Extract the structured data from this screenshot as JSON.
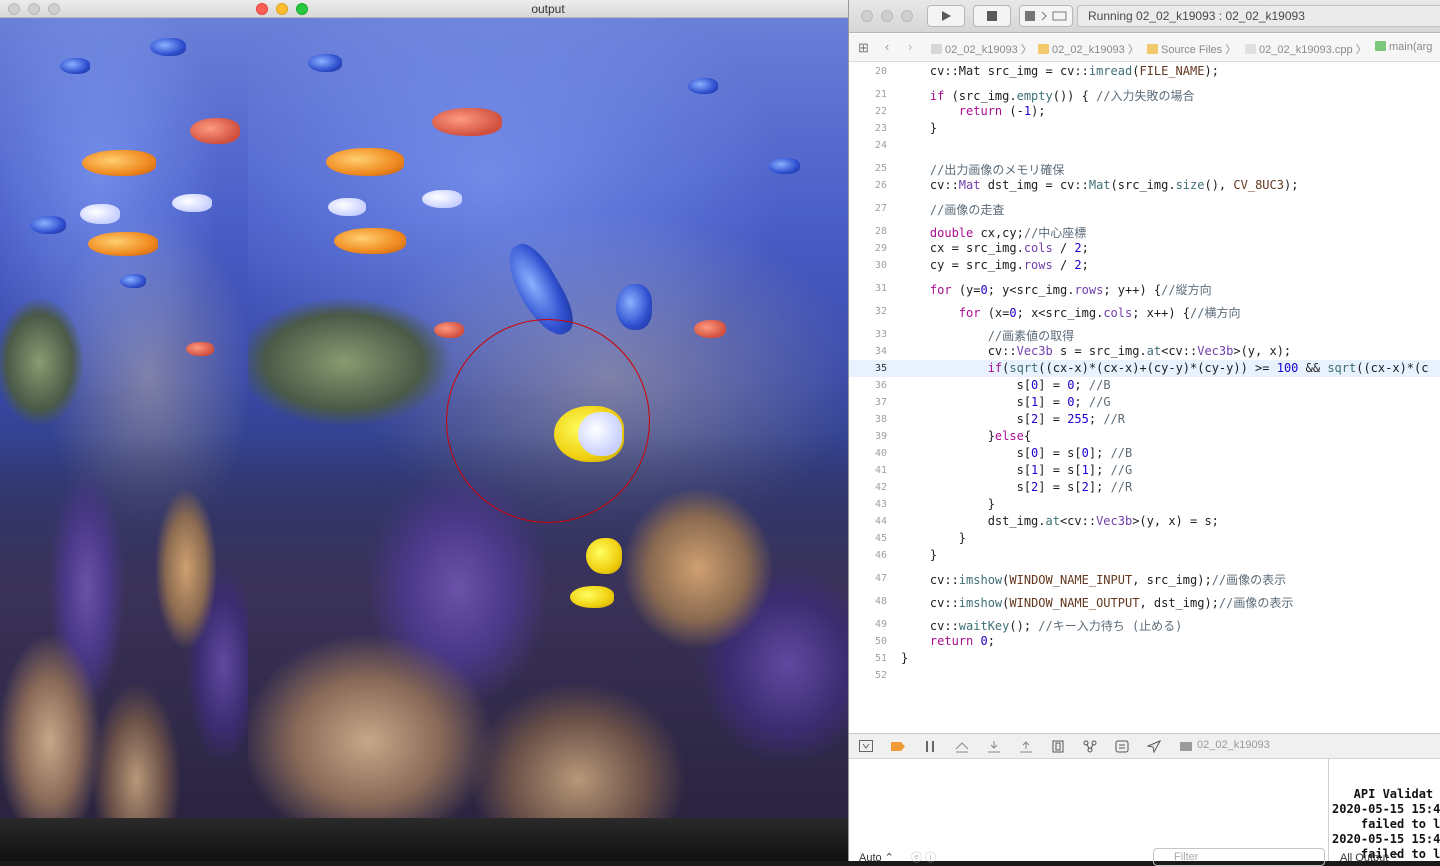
{
  "input_window": {
    "title": ""
  },
  "output_window": {
    "title": "output"
  },
  "xcode": {
    "status": "Running 02_02_k19093 : 02_02_k19093",
    "breadcrumb": [
      "02_02_k19093",
      "02_02_k19093",
      "Source Files",
      "02_02_k19093.cpp",
      "main(arg"
    ],
    "current_line": 35,
    "code_lines": [
      {
        "n": "20",
        "html": "    cv::Mat src_img = cv::<span class='fn'>imread</span>(<span class='cnst'>FILE_NAME</span>);"
      },
      {
        "n": "21",
        "html": "    <span class='kw'>if</span> (src_img.<span class='fn'>empty</span>()) { <span class='cm'>//入力失敗の場合</span>"
      },
      {
        "n": "22",
        "html": "        <span class='kw'>return</span> (-<span class='num'>1</span>);"
      },
      {
        "n": "23",
        "html": "    }"
      },
      {
        "n": "24",
        "html": ""
      },
      {
        "n": "25",
        "html": "    <span class='cm'>//出力画像のメモリ確保</span>"
      },
      {
        "n": "26",
        "html": "    cv::<span class='ty'>Mat</span> dst_img = cv::<span class='fn'>Mat</span>(src_img.<span class='fn'>size</span>(), <span class='cnst'>CV_8UC3</span>);"
      },
      {
        "n": "27",
        "html": "    <span class='cm'>//画像の走査</span>"
      },
      {
        "n": "28",
        "html": "    <span class='kw'>double</span> cx,cy;<span class='cm'>//中心座標</span>"
      },
      {
        "n": "29",
        "html": "    cx = src_img.<span class='ty'>cols</span> / <span class='num'>2</span>;"
      },
      {
        "n": "30",
        "html": "    cy = src_img.<span class='ty'>rows</span> / <span class='num'>2</span>;"
      },
      {
        "n": "31",
        "html": "    <span class='kw'>for</span> (y=<span class='num'>0</span>; y&lt;src_img.<span class='ty'>rows</span>; y++) {<span class='cm'>//縦方向</span>"
      },
      {
        "n": "32",
        "html": "        <span class='kw'>for</span> (x=<span class='num'>0</span>; x&lt;src_img.<span class='ty'>cols</span>; x++) {<span class='cm'>//横方向</span>"
      },
      {
        "n": "33",
        "html": "            <span class='cm'>//画素値の取得</span>"
      },
      {
        "n": "34",
        "html": "            cv::<span class='ty'>Vec3b</span> s = src_img.<span class='fn'>at</span>&lt;cv::<span class='ty'>Vec3b</span>&gt;(y, x);"
      },
      {
        "n": "35",
        "html": "            <span class='kw'>if</span>(<span class='fn'>sqrt</span>((cx-x)*(cx-x)+(cy-y)*(cy-y)) &gt;= <span class='num'>100</span> &amp;&amp; <span class='fn'>sqrt</span>((cx-x)*(c"
      },
      {
        "n": "36",
        "html": "                s[<span class='num'>0</span>] = <span class='num'>0</span>; <span class='cm'>//B</span>"
      },
      {
        "n": "37",
        "html": "                s[<span class='num'>1</span>] = <span class='num'>0</span>; <span class='cm'>//G</span>"
      },
      {
        "n": "38",
        "html": "                s[<span class='num'>2</span>] = <span class='num'>255</span>; <span class='cm'>//R</span>"
      },
      {
        "n": "39",
        "html": "            }<span class='kw'>else</span>{"
      },
      {
        "n": "40",
        "html": "                s[<span class='num'>0</span>] = s[<span class='num'>0</span>]; <span class='cm'>//B</span>"
      },
      {
        "n": "41",
        "html": "                s[<span class='num'>1</span>] = s[<span class='num'>1</span>]; <span class='cm'>//G</span>"
      },
      {
        "n": "42",
        "html": "                s[<span class='num'>2</span>] = s[<span class='num'>2</span>]; <span class='cm'>//R</span>"
      },
      {
        "n": "43",
        "html": "            }"
      },
      {
        "n": "44",
        "html": "            dst_img.<span class='fn'>at</span>&lt;cv::<span class='ty'>Vec3b</span>&gt;(y, x) = s;"
      },
      {
        "n": "45",
        "html": "        }"
      },
      {
        "n": "46",
        "html": "    }"
      },
      {
        "n": "47",
        "html": "    cv::<span class='fn'>imshow</span>(<span class='cnst'>WINDOW_NAME_INPUT</span>, src_img);<span class='cm'>//画像の表示</span>"
      },
      {
        "n": "48",
        "html": "    cv::<span class='fn'>imshow</span>(<span class='cnst'>WINDOW_NAME_OUTPUT</span>, dst_img);<span class='cm'>//画像の表示</span>"
      },
      {
        "n": "49",
        "html": "    cv::<span class='fn'>waitKey</span>(); <span class='cm'>//キー入力待ち (止める)</span>"
      },
      {
        "n": "50",
        "html": "    <span class='kw'>return</span> <span class='num'>0</span>;"
      },
      {
        "n": "51",
        "html": "}"
      },
      {
        "n": "52",
        "html": ""
      }
    ],
    "debug_target": "02_02_k19093",
    "console_lines": [
      "   API Validat",
      "2020-05-15 15:4",
      "    failed to l",
      "2020-05-15 15:4",
      "    failed to l"
    ],
    "auto_label": "Auto ⌃",
    "filter_placeholder": "Filter",
    "all_output_label": "All Output ⌃"
  }
}
